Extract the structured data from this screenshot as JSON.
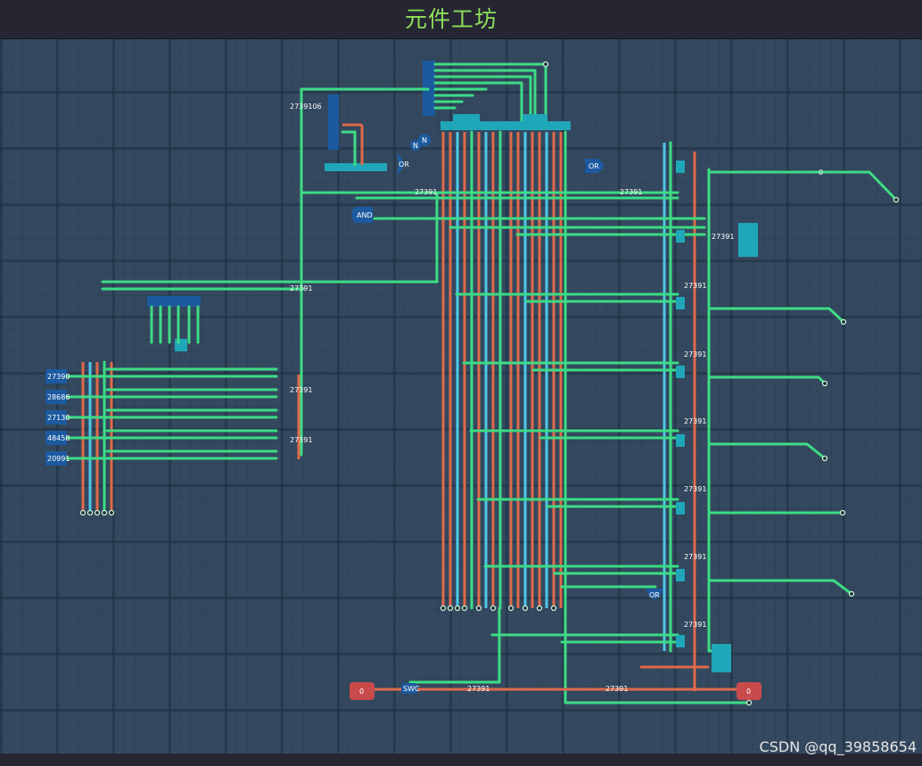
{
  "app": {
    "title": "元件工坊"
  },
  "watermark": "CSDN @qq_39858654",
  "colors": {
    "wire_green": "#3ddc84",
    "wire_red": "#e0694a",
    "wire_blue": "#4ec7e8",
    "chip": "#1fa6b8",
    "switch": "#1c5aa0",
    "lamp": "#c84a4a"
  },
  "inputs": {
    "values": [
      "27390",
      "28686",
      "27130",
      "48458",
      "20991"
    ]
  },
  "gates": {
    "or_1": "OR",
    "or_2": "OR",
    "or_3": "OR",
    "and_1": "AND",
    "not_1": "N",
    "not_2": "N"
  },
  "labels": {
    "val_top": "27391",
    "val_top_2": "27391",
    "val_top_3": "27391",
    "val_mid": "27391",
    "bus_a": "27391",
    "bus_b": "27391",
    "bus_c": "27391",
    "bus_d": "27391",
    "bottom_a": "27391",
    "bottom_b": "27391",
    "left_val": "27391",
    "left_val2": "27391",
    "left_val3": "27391",
    "zero": "0",
    "switch_text": "SWC",
    "small_value": "2739106",
    "chip_text": "27391"
  },
  "outputs": {
    "lamp_left": "0",
    "lamp_right": "0"
  }
}
